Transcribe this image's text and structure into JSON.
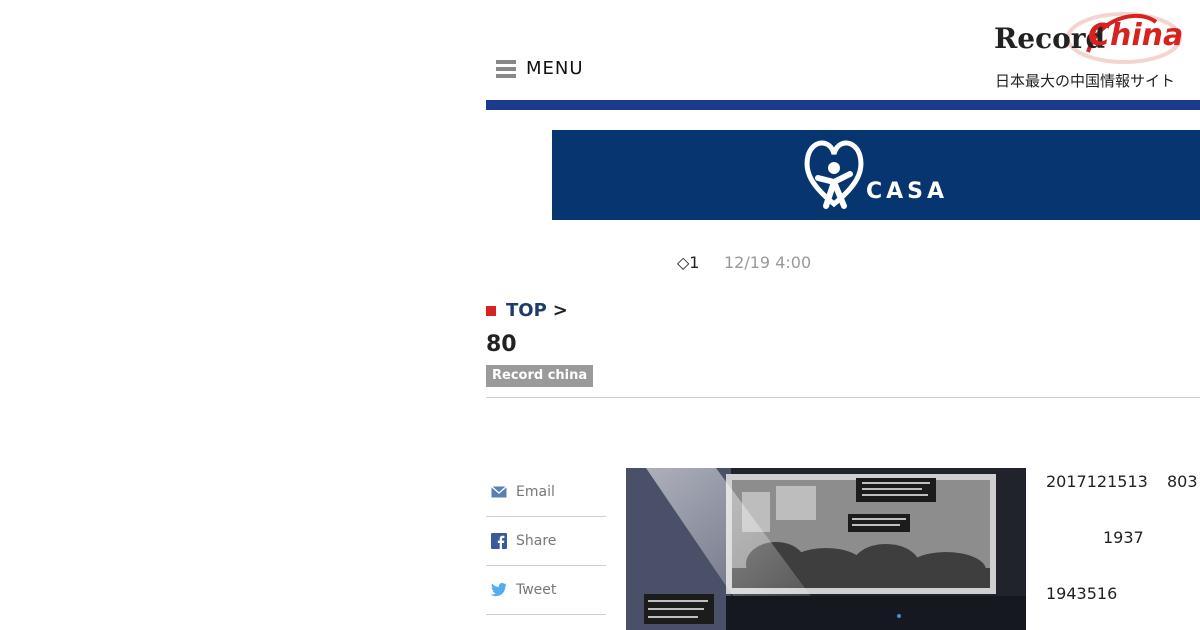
{
  "header": {
    "menu_label": "MENU",
    "logo": {
      "word": "Record",
      "china": "China",
      "tagline": "日本最大の中国情報サイト"
    }
  },
  "banner": {
    "brand": "CASA",
    "background_color": "#06356f"
  },
  "article": {
    "count": "◇1",
    "date": "12/19 4:00",
    "breadcrumb": {
      "top": "TOP",
      "separator": ">"
    },
    "title": "80",
    "source": "Record china",
    "paragraphs": [
      {
        "text": "2017121513",
        "extra": "803"
      },
      {
        "text": "1937"
      },
      {
        "text": "1943516"
      }
    ]
  },
  "share": {
    "items": [
      {
        "label": "Email",
        "icon": "email-icon"
      },
      {
        "label": "Share",
        "icon": "facebook-icon"
      },
      {
        "label": "Tweet",
        "icon": "twitter-icon"
      }
    ]
  },
  "colors": {
    "accent_red": "#d7231f",
    "nav_blue": "#1d3b8c",
    "breadcrumb_blue": "#1d3b6c"
  }
}
